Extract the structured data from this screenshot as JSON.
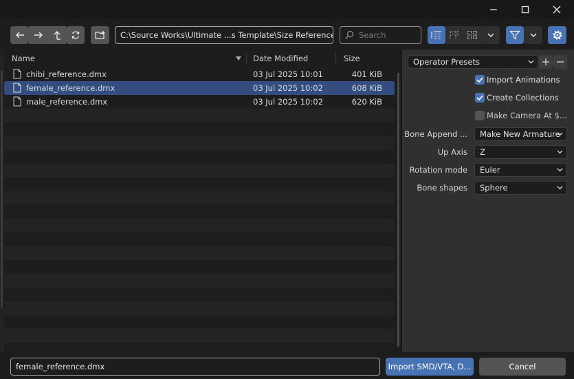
{
  "window": {
    "minimize_icon": "minimize-icon",
    "maximize_icon": "maximize-icon",
    "close_icon": "close-icon"
  },
  "toolbar": {
    "path": "C:\\Source Works\\Ultimate ...s Template\\Size Reference\\",
    "search_placeholder": "Search"
  },
  "file_list": {
    "columns": {
      "name": "Name",
      "date": "Date Modified",
      "size": "Size"
    },
    "rows": [
      {
        "name": "chibi_reference.dmx",
        "date": "03 Jul 2025 10:01",
        "size": "401 KiB",
        "selected": false
      },
      {
        "name": "female_reference.dmx",
        "date": "03 Jul 2025 10:02",
        "size": "608 KiB",
        "selected": true
      },
      {
        "name": "male_reference.dmx",
        "date": "03 Jul 2025 10:02",
        "size": "620 KiB",
        "selected": false
      }
    ]
  },
  "options": {
    "presets": "Operator Presets",
    "import_animations": {
      "label": "Import Animations",
      "checked": true
    },
    "create_collections": {
      "label": "Create Collections",
      "checked": true
    },
    "make_camera": {
      "label": "Make Camera At $...",
      "checked": false
    },
    "bone_append": {
      "label": "Bone Append ...",
      "value": "Make New Armature"
    },
    "up_axis": {
      "label": "Up Axis",
      "value": "Z"
    },
    "rotation_mode": {
      "label": "Rotation mode",
      "value": "Euler"
    },
    "bone_shapes": {
      "label": "Bone shapes",
      "value": "Sphere"
    }
  },
  "footer": {
    "filename": "female_reference.dmx",
    "action_label": "Import SMD/VTA, D...",
    "cancel_label": "Cancel"
  },
  "colors": {
    "accent": "#4772b3",
    "selection": "#334d80",
    "panel": "#303030",
    "background": "#1d1d1d"
  }
}
